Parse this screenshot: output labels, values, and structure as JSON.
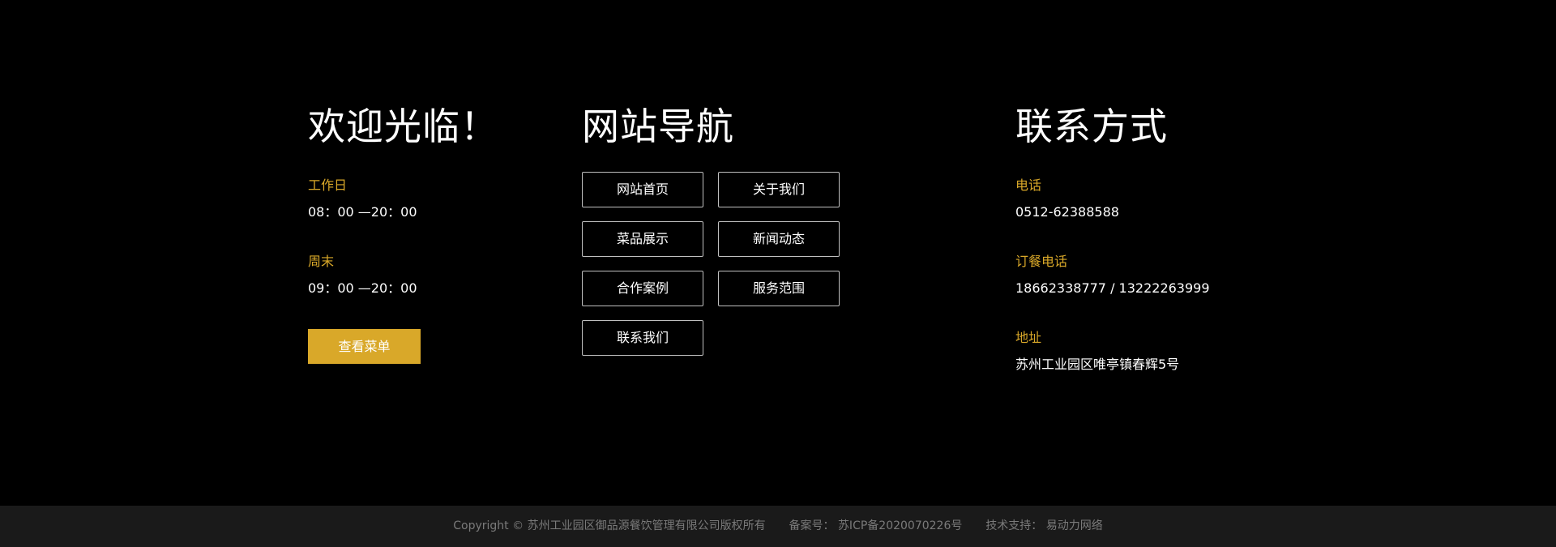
{
  "welcome": {
    "title": "欢迎光临！",
    "workday_label": "工作日",
    "workday_hours": "08：00 —20：00",
    "weekend_label": "周末",
    "weekend_hours": "09：00 —20：00",
    "menu_button": "查看菜单"
  },
  "nav": {
    "title": "网站导航",
    "items": [
      {
        "label": "网站首页"
      },
      {
        "label": "关于我们"
      },
      {
        "label": "菜品展示"
      },
      {
        "label": "新闻动态"
      },
      {
        "label": "合作案例"
      },
      {
        "label": "服务范围"
      },
      {
        "label": "联系我们"
      }
    ]
  },
  "contact": {
    "title": "联系方式",
    "phone_label": "电话",
    "phone_value": "0512-62388588",
    "order_label": "订餐电话",
    "order_value": "18662338777 / 13222263999",
    "address_label": "地址",
    "address_value": "苏州工业园区唯亭镇春辉5号"
  },
  "bottom": {
    "copyright": "Copyright © 苏州工业园区御品源餐饮管理有限公司版权所有",
    "icp_label": "备案号：",
    "icp_value": "苏ICP备2020070226号",
    "tech_label": "技术支持：",
    "tech_value": "易动力网络"
  },
  "colors": {
    "background": "#000000",
    "accent": "#d9a829",
    "bottom_bar": "#1a1a1a",
    "bottom_text": "#7a7a7a"
  }
}
